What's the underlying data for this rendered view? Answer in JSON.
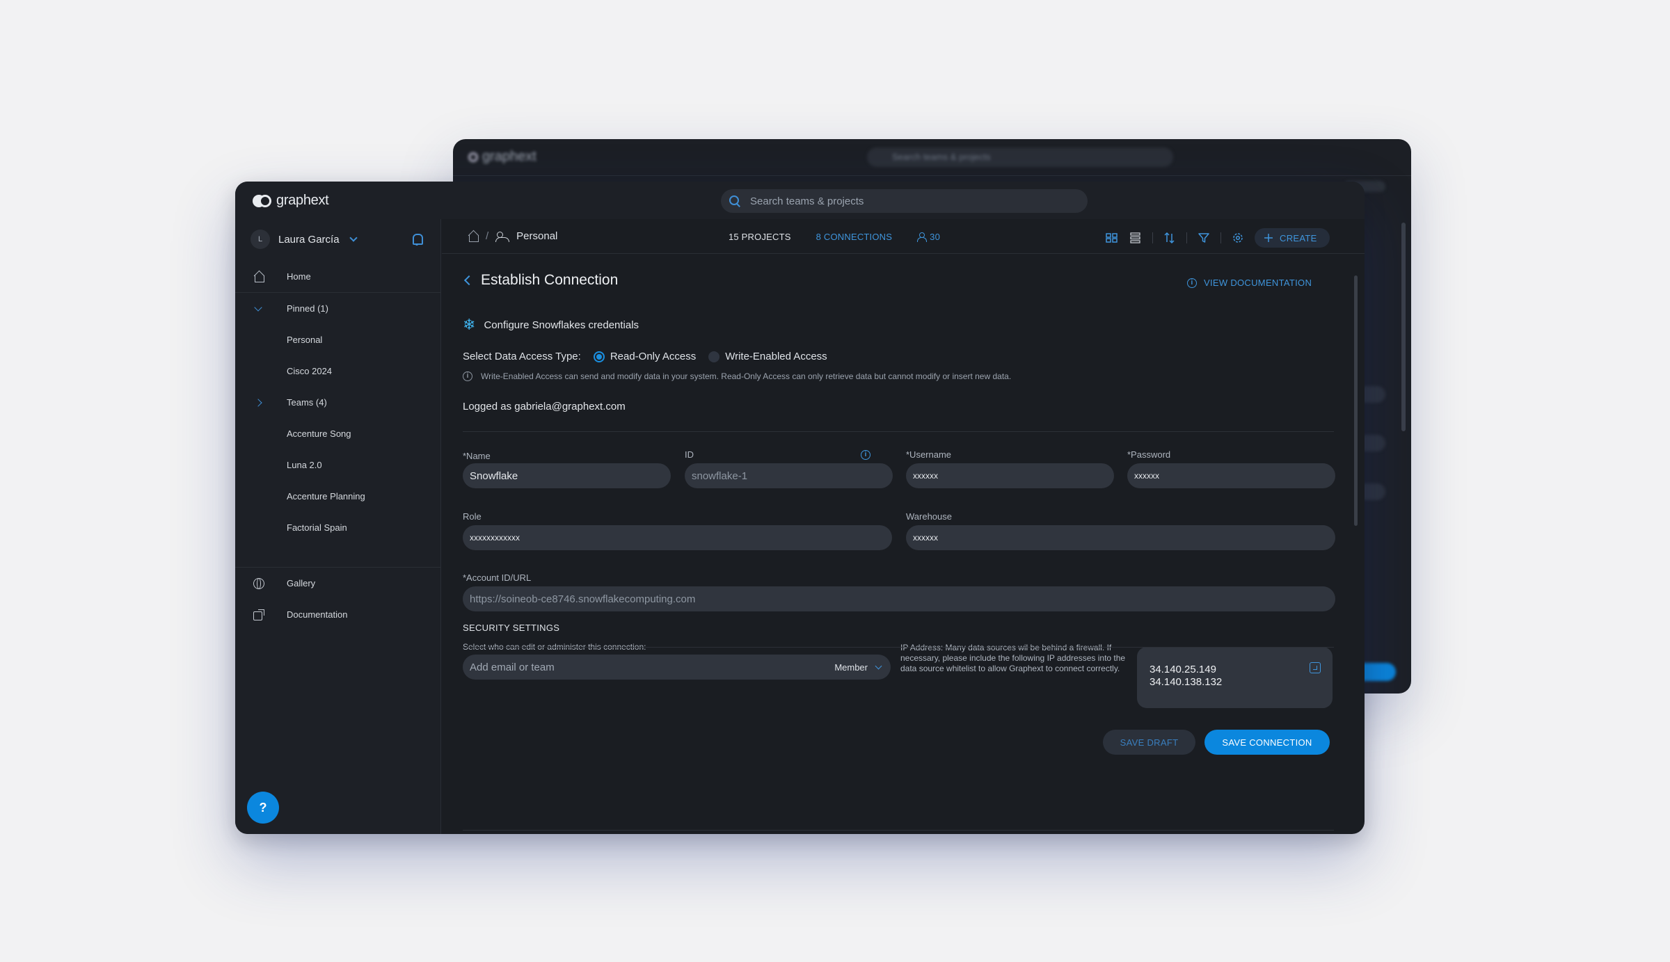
{
  "colors": {
    "accent": "#0b87de",
    "accent_text": "#3f95dc",
    "window_bg": "#1a1d22",
    "field_bg": "#30353e",
    "page_bg": "#f2f2f3"
  },
  "background_window": {
    "logo_text": "graphext",
    "search_placeholder": "Search teams & projects"
  },
  "topbar": {
    "logo_text": "graphext",
    "search_placeholder": "Search teams & projects",
    "search_icon": "search-icon"
  },
  "sidebar": {
    "user": {
      "initial": "L",
      "name": "Laura García"
    },
    "items": [
      {
        "label": "Home",
        "icon": "home-icon"
      },
      {
        "label": "Pinned (1)",
        "icon": "chevron-down-icon"
      },
      {
        "label": "Personal"
      },
      {
        "label": "Cisco 2024"
      },
      {
        "label": "Teams (4)",
        "icon": "chevron-right-icon"
      },
      {
        "label": "Accenture Song"
      },
      {
        "label": "Luna 2.0"
      },
      {
        "label": "Accenture Planning"
      },
      {
        "label": "Factorial Spain"
      }
    ],
    "bottom_items": [
      {
        "label": "Gallery",
        "icon": "globe-icon"
      },
      {
        "label": "Documentation",
        "icon": "external-link-icon"
      }
    ],
    "help_icon": "?"
  },
  "subheader": {
    "breadcrumb_current": "Personal",
    "breadcrumb_separator": "/",
    "projects": "15 PROJECTS",
    "connections": "8 CONNECTIONS",
    "users": "30",
    "create_label": "CREATE"
  },
  "page": {
    "title": "Establish Connection",
    "view_documentation": "VIEW DOCUMENTATION",
    "configure_title": "Configure Snowflakes credentials",
    "access_label": "Select Data Access Type:",
    "access_options": [
      {
        "label": "Read-Only Access",
        "selected": true
      },
      {
        "label": "Write-Enabled Access",
        "selected": false
      }
    ],
    "access_note": "Write-Enabled Access can send and modify data in your system. Read-Only Access can only retrieve data but cannot modify or insert new data.",
    "logged_as": "Logged as gabriela@graphext.com"
  },
  "form": {
    "name": {
      "label": "*Name",
      "value": "Snowflake"
    },
    "id": {
      "label": "ID",
      "value": "snowflake-1"
    },
    "username": {
      "label": "*Username",
      "value": "xxxxxx"
    },
    "password": {
      "label": "*Password",
      "value": "xxxxxx"
    },
    "role": {
      "label": "Role",
      "value": "xxxxxxxxxxxx"
    },
    "warehouse": {
      "label": "Warehouse",
      "value": "xxxxxx"
    },
    "account": {
      "label": "*Account ID/URL",
      "value": "https://soineob-ce8746.snowflakecomputing.com"
    }
  },
  "security": {
    "title": "SECURITY SETTINGS",
    "subtitle": "Select who can edit or administer this connection:",
    "email_placeholder": "Add email  or team",
    "role_selected": "Member",
    "ip_note": "IP Address: Many data sources wil be behind a firewall. If necessary, please include the following IP addresses into the data source whitelist to allow Graphext to connect correctly.",
    "ips": [
      "34.140.25.149",
      "34.140.138.132"
    ]
  },
  "actions": {
    "save_draft": "SAVE DRAFT",
    "save_connection": "SAVE CONNECTION"
  }
}
